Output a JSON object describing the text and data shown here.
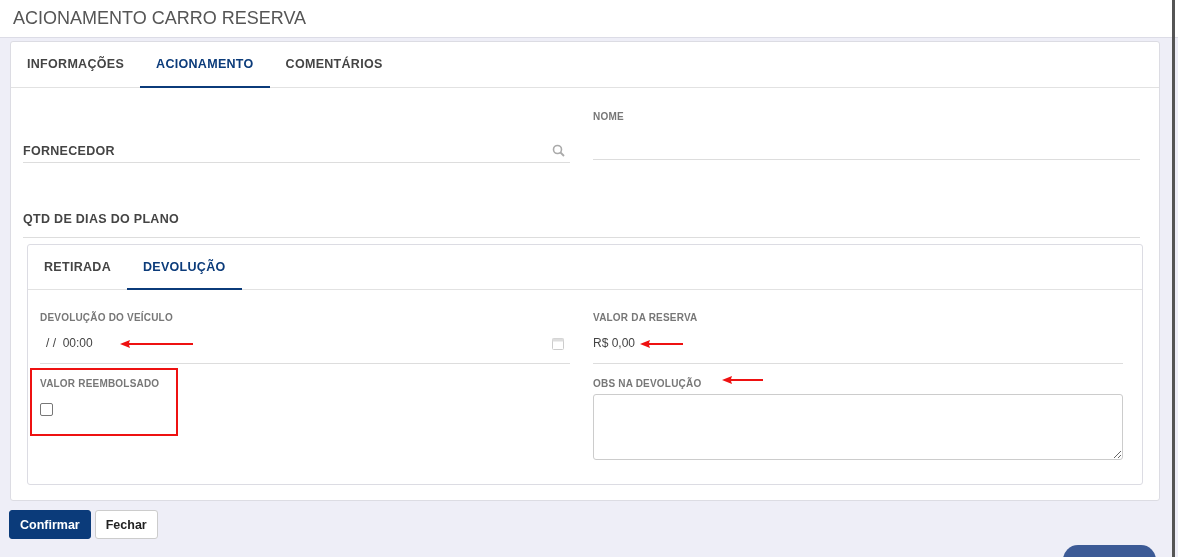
{
  "page_title": "ACIONAMENTO CARRO RESERVA",
  "tabs": [
    {
      "label": "INFORMAÇÕES",
      "selected": false
    },
    {
      "label": "ACIONAMENTO",
      "selected": true
    },
    {
      "label": "COMENTÁRIOS",
      "selected": false
    }
  ],
  "fornecedor": {
    "label": "FORNECEDOR"
  },
  "nome": {
    "label": "NOME"
  },
  "qtd_dias": {
    "label": "QTD DE DIAS DO PLANO"
  },
  "sub_tabs": [
    {
      "label": "RETIRADA",
      "selected": false
    },
    {
      "label": "DEVOLUÇÃO",
      "selected": true
    }
  ],
  "devolucao_veiculo": {
    "label": "DEVOLUÇÃO DO VEÍCULO",
    "value": "/ /  00:00"
  },
  "valor_reserva": {
    "label": "VALOR DA RESERVA",
    "value": "R$ 0,00"
  },
  "valor_reembolsado": {
    "label": "VALOR REEMBOLSADO",
    "checked": false
  },
  "obs_devolucao": {
    "label": "OBS NA DEVOLUÇÃO"
  },
  "buttons": [
    {
      "label": "Confirmar",
      "kind": "primary"
    },
    {
      "label": "Fechar",
      "kind": "secondary"
    }
  ]
}
